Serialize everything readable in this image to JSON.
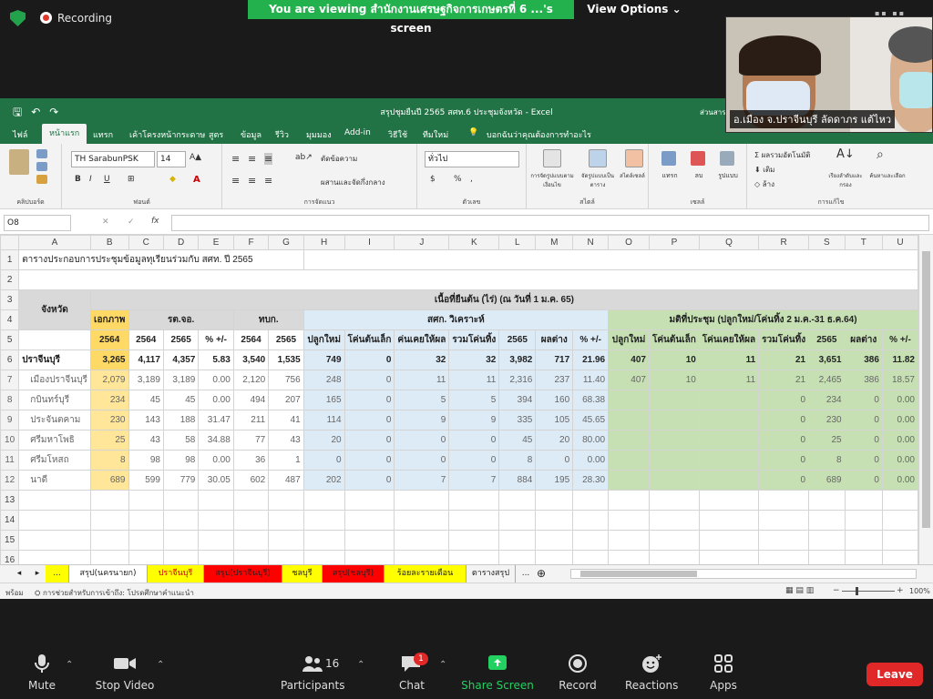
{
  "zoom": {
    "recording": "Recording",
    "viewing": "You are viewing สำนักงานเศรษฐกิจการเกษตรที่ 6 ...'s screen",
    "view_options": "View Options",
    "participant_name": "อ.เมือง จ.ปราจีนบุรี ลัดดาภร แต้ไหว",
    "participants_count": "16",
    "chat_badge": "1",
    "controls": [
      "Mute",
      "Stop Video",
      "Participants",
      "Chat",
      "Share Screen",
      "Record",
      "Reactions",
      "Apps"
    ],
    "leave": "Leave",
    "share_color": "#23d160",
    "leave_color": "#e02828"
  },
  "excel": {
    "title": "สรุปชุมยืนปี 2565 สศท.6 ประชุมจังหวัด - Excel",
    "title_right": "ส่วนสารสนเทศ",
    "menu": [
      "ไฟล์",
      "หน้าแรก",
      "แทรก",
      "เค้าโครงหน้ากระดาษ",
      "สูตร",
      "ข้อมูล",
      "รีวิว",
      "มุมมอง",
      "Add-in",
      "วิธีใช้",
      "ทีมใหม่"
    ],
    "tell_me": "บอกฉันว่าคุณต้องการทำอะไร",
    "font": "TH SarabunPSK",
    "size": "14",
    "wrap": "ตัดข้อความ",
    "merge": "ผสานและจัดกึ่งกลาง",
    "numfmt": "ทั่วไป",
    "groups": [
      "คลิปบอร์ด",
      "ฟอนต์",
      "การจัดแนว",
      "ตัวเลข",
      "สไตล์",
      "เซลล์",
      "การแก้ไข"
    ],
    "style_btns": [
      "การจัดรูปแบบตามเงื่อนไข",
      "จัดรูปแบบเป็นตาราง",
      "สไตล์เซลล์"
    ],
    "cell_btns": [
      "แทรก",
      "ลบ",
      "รูปแบบ"
    ],
    "edit_btns": [
      "ผลรวมอัตโนมัติ",
      "เติม",
      "ล้าง",
      "เรียงลำดับและกรอง",
      "ค้นหาและเลือก"
    ],
    "cell_ref": "O8",
    "fx": "fx",
    "status": "พร้อม",
    "status_note": "การช่วยสำหรับการเข้าถึง: โปรดศึกษาคำแนะนำ",
    "zoom": "100%",
    "tabs": [
      {
        "label": "...",
        "bg": "#f3f3f3"
      },
      {
        "label": "สรุป(นครนายก)",
        "bg": "#ffff00"
      },
      {
        "label": "ปราจีนบุรี",
        "bg": "#ffffff"
      },
      {
        "label": "สรุป(ปราจีนบุรี)",
        "bg": "#ffff00"
      },
      {
        "label": "ชลบุรี",
        "bg": "#ff0000"
      },
      {
        "label": "สรุป(ชลบุรี)",
        "bg": "#ffff00"
      },
      {
        "label": "ร้อยละรายเดือน",
        "bg": "#ff0000"
      },
      {
        "label": "ตารางสรุป",
        "bg": "#ffff00"
      },
      {
        "label": "...",
        "bg": "#f3f3f3"
      }
    ]
  },
  "sheet": {
    "cols": [
      "A",
      "B",
      "C",
      "D",
      "E",
      "F",
      "G",
      "H",
      "I",
      "J",
      "K",
      "L",
      "M",
      "N",
      "O",
      "P",
      "Q",
      "R",
      "S",
      "T",
      "U"
    ],
    "r1": "ตารางประกอบการประชุมข้อมูลทุเรียนร่วมกับ สศท. ปี 2565",
    "r3a": "จังหวัด",
    "r3h": "เนื้อที่ยืนต้น (ไร่) (ณ วันที่ 1 ม.ค. 65)",
    "r4": [
      "เอกภาพ",
      "รต.จอ.",
      "ทบก.",
      "สศก. วิเคราะห์",
      "มติที่ประชุม (ปลูกใหม่/โค่นทิ้ง 2 ม.ค.-31 ธ.ค.64)"
    ],
    "r5": [
      "2564",
      "2564",
      "2565",
      "% +/-",
      "2564",
      "2565",
      "ปลูกใหม่",
      "โค่นต้นเล็ก",
      "ค่นเคยให้ผล",
      "รวมโค่นทิ้ง",
      "2565",
      "ผลต่าง",
      "% +/-",
      "ปลูกใหม่",
      "โค่นต้นเล็ก",
      "โค่นเคยให้ผล",
      "รวมโค่นทิ้ง",
      "2565",
      "ผลต่าง",
      "% +/-"
    ],
    "rows": [
      [
        "ปราจีนบุรี",
        "3,265",
        "4,117",
        "4,357",
        "5.83",
        "3,540",
        "1,535",
        "749",
        "0",
        "32",
        "32",
        "3,982",
        "717",
        "21.96",
        "407",
        "10",
        "11",
        "21",
        "3,651",
        "386",
        "11.82"
      ],
      [
        "เมืองปราจีนบุรี",
        "2,079",
        "3,189",
        "3,189",
        "0.00",
        "2,120",
        "756",
        "248",
        "0",
        "11",
        "11",
        "2,316",
        "237",
        "11.40",
        "407",
        "10",
        "11",
        "21",
        "2,465",
        "386",
        "18.57"
      ],
      [
        "กบินทร์บุรี",
        "234",
        "45",
        "45",
        "0.00",
        "494",
        "207",
        "165",
        "0",
        "5",
        "5",
        "394",
        "160",
        "68.38",
        "",
        "",
        "",
        "0",
        "234",
        "0",
        "0.00"
      ],
      [
        "ประจันตคาม",
        "230",
        "143",
        "188",
        "31.47",
        "211",
        "41",
        "114",
        "0",
        "9",
        "9",
        "335",
        "105",
        "45.65",
        "",
        "",
        "",
        "0",
        "230",
        "0",
        "0.00"
      ],
      [
        "ศรีมหาโพธิ",
        "25",
        "43",
        "58",
        "34.88",
        "77",
        "43",
        "20",
        "0",
        "0",
        "0",
        "45",
        "20",
        "80.00",
        "",
        "",
        "",
        "0",
        "25",
        "0",
        "0.00"
      ],
      [
        "ศรีมโหสถ",
        "8",
        "98",
        "98",
        "0.00",
        "36",
        "1",
        "0",
        "0",
        "0",
        "0",
        "8",
        "0",
        "0.00",
        "",
        "",
        "",
        "0",
        "8",
        "0",
        "0.00"
      ],
      [
        "นาดี",
        "689",
        "599",
        "779",
        "30.05",
        "602",
        "487",
        "202",
        "0",
        "7",
        "7",
        "884",
        "195",
        "28.30",
        "",
        "",
        "",
        "0",
        "689",
        "0",
        "0.00"
      ]
    ],
    "row_nums": [
      "1",
      "2",
      "3",
      "4",
      "5",
      "6",
      "7",
      "8",
      "9",
      "10",
      "11",
      "12",
      "13",
      "14",
      "15",
      "16"
    ]
  }
}
